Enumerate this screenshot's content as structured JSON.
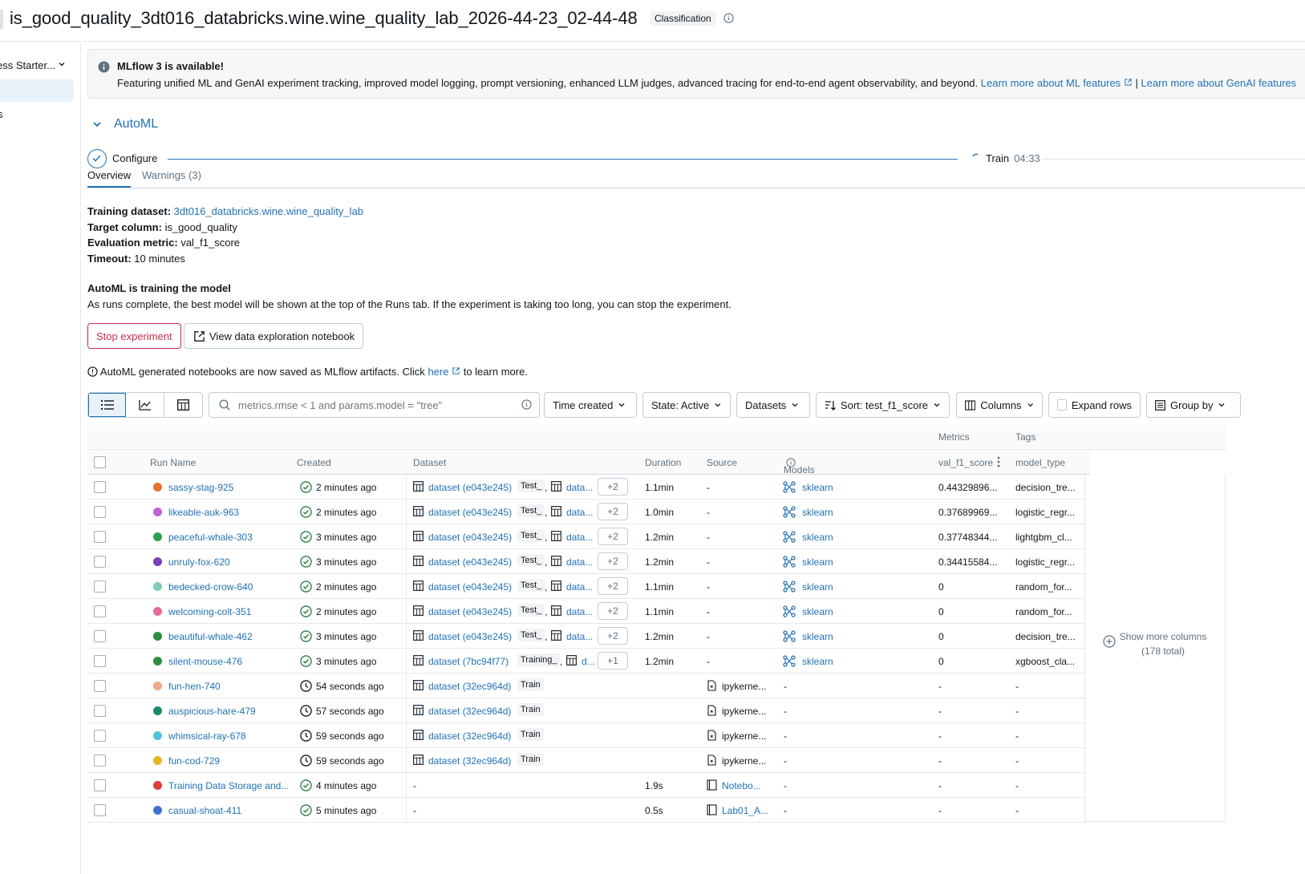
{
  "header": {
    "title": "is_good_quality_3dt016_databricks.wine.wine_quality_lab_2026-44-23_02-44-48",
    "badge": "Classification"
  },
  "sidebar": {
    "selector": "ess Starter...",
    "item2": "s"
  },
  "banner": {
    "title": "MLflow 3 is available!",
    "body": "Featuring unified ML and GenAI experiment tracking, improved model logging, prompt versioning, enhanced LLM judges, advanced tracing for end-to-end agent observability, and beyond.",
    "link1": "Learn more about ML features",
    "separator": "|",
    "link2": "Learn more about GenAI features"
  },
  "automl": {
    "section_title": "AutoML",
    "step1": "Configure",
    "step2": "Train",
    "step2_time": "04:33",
    "tabs": [
      "Overview",
      "Warnings (3)"
    ]
  },
  "info": {
    "training_dataset_label": "Training dataset:",
    "training_dataset": "3dt016_databricks.wine.wine_quality_lab",
    "target_label": "Target column:",
    "target": "is_good_quality",
    "metric_label": "Evaluation metric:",
    "metric": "val_f1_score",
    "timeout_label": "Timeout:",
    "timeout": "10 minutes",
    "status_title": "AutoML is training the model",
    "status_body": "As runs complete, the best model will be shown at the top of the Runs tab. If the experiment is taking too long, you can stop the experiment."
  },
  "actions": {
    "stop": "Stop experiment",
    "view_notebook": "View data exploration notebook"
  },
  "notice": {
    "text_before": "AutoML generated notebooks are now saved as MLflow artifacts. Click",
    "link": "here",
    "text_after": "to learn more."
  },
  "toolbar": {
    "search_placeholder": "metrics.rmse < 1 and params.model = \"tree\"",
    "time_created": "Time created",
    "state": "State: Active",
    "datasets": "Datasets",
    "sort": "Sort: test_f1_score",
    "columns": "Columns",
    "expand_rows": "Expand rows",
    "group_by": "Group by"
  },
  "table": {
    "group_metrics": "Metrics",
    "group_tags": "Tags",
    "columns": [
      "Run Name",
      "Created",
      "Dataset",
      "Duration",
      "Source",
      "Models",
      "val_f1_score",
      "model_type"
    ],
    "show_more": "Show more columns (178 total)",
    "rows": [
      {
        "name": "sassy-stag-925",
        "color": "#e8702a",
        "status": "done",
        "created": "2 minutes ago",
        "ds": "dataset (e043e245)",
        "tag": "Test_",
        "ds2": "data...",
        "more": "+2",
        "duration": "1.1min",
        "source": "-",
        "model": "sklearn",
        "metric": "0.44329896...",
        "type": "decision_tre..."
      },
      {
        "name": "likeable-auk-963",
        "color": "#c45fd6",
        "status": "done",
        "created": "2 minutes ago",
        "ds": "dataset (e043e245)",
        "tag": "Test_",
        "ds2": "data...",
        "more": "+2",
        "duration": "1.0min",
        "source": "-",
        "model": "sklearn",
        "metric": "0.37689969...",
        "type": "logistic_regr..."
      },
      {
        "name": "peaceful-whale-303",
        "color": "#2f9e4f",
        "status": "done",
        "created": "3 minutes ago",
        "ds": "dataset (e043e245)",
        "tag": "Test_",
        "ds2": "data...",
        "more": "+2",
        "duration": "1.2min",
        "source": "-",
        "model": "sklearn",
        "metric": "0.37748344...",
        "type": "lightgbm_cl..."
      },
      {
        "name": "unruly-fox-620",
        "color": "#7b3fb5",
        "status": "done",
        "created": "3 minutes ago",
        "ds": "dataset (e043e245)",
        "tag": "Test_",
        "ds2": "data...",
        "more": "+2",
        "duration": "1.2min",
        "source": "-",
        "model": "sklearn",
        "metric": "0.34415584...",
        "type": "logistic_regr..."
      },
      {
        "name": "bedecked-crow-640",
        "color": "#7fcdb8",
        "status": "done",
        "created": "2 minutes ago",
        "ds": "dataset (e043e245)",
        "tag": "Test_",
        "ds2": "data...",
        "more": "+2",
        "duration": "1.1min",
        "source": "-",
        "model": "sklearn",
        "metric": "0",
        "type": "random_for..."
      },
      {
        "name": "welcoming-colt-351",
        "color": "#e56b9a",
        "status": "done",
        "created": "2 minutes ago",
        "ds": "dataset (e043e245)",
        "tag": "Test_",
        "ds2": "data...",
        "more": "+2",
        "duration": "1.1min",
        "source": "-",
        "model": "sklearn",
        "metric": "0",
        "type": "random_for..."
      },
      {
        "name": "beautiful-whale-462",
        "color": "#2f8f3f",
        "status": "done",
        "created": "3 minutes ago",
        "ds": "dataset (e043e245)",
        "tag": "Test_",
        "ds2": "data...",
        "more": "+2",
        "duration": "1.2min",
        "source": "-",
        "model": "sklearn",
        "metric": "0",
        "type": "decision_tre..."
      },
      {
        "name": "silent-mouse-476",
        "color": "#2f8f3f",
        "status": "done",
        "created": "3 minutes ago",
        "ds": "dataset (7bc94f77)",
        "tag": "Training_",
        "ds2": "d...",
        "more": "+1",
        "duration": "1.2min",
        "source": "-",
        "model": "sklearn",
        "metric": "0",
        "type": "xgboost_cla..."
      },
      {
        "name": "fun-hen-740",
        "color": "#f0a98a",
        "status": "running",
        "created": "54 seconds ago",
        "ds": "dataset (32ec964d)",
        "tag": "Train",
        "ds2": "",
        "more": "",
        "duration": "",
        "source": "ipykerne...",
        "model": "-",
        "metric": "-",
        "type": "-"
      },
      {
        "name": "auspicious-hare-479",
        "color": "#1a8a6e",
        "status": "running",
        "created": "57 seconds ago",
        "ds": "dataset (32ec964d)",
        "tag": "Train",
        "ds2": "",
        "more": "",
        "duration": "",
        "source": "ipykerne...",
        "model": "-",
        "metric": "-",
        "type": "-"
      },
      {
        "name": "whimsical-ray-678",
        "color": "#4fc3d9",
        "status": "running",
        "created": "59 seconds ago",
        "ds": "dataset (32ec964d)",
        "tag": "Train",
        "ds2": "",
        "more": "",
        "duration": "",
        "source": "ipykerne...",
        "model": "-",
        "metric": "-",
        "type": "-"
      },
      {
        "name": "fun-cod-729",
        "color": "#e8b520",
        "status": "running",
        "created": "59 seconds ago",
        "ds": "dataset (32ec964d)",
        "tag": "Train",
        "ds2": "",
        "more": "",
        "duration": "",
        "source": "ipykerne...",
        "model": "-",
        "metric": "-",
        "type": "-"
      },
      {
        "name": "Training Data Storage and...",
        "color": "#e03b3b",
        "status": "done",
        "created": "4 minutes ago",
        "ds": "-",
        "tag": "",
        "ds2": "",
        "more": "",
        "duration": "1.9s",
        "source": "Notebo...",
        "model": "-",
        "metric": "-",
        "type": "-"
      },
      {
        "name": "casual-shoat-411",
        "color": "#3d6fd6",
        "status": "done",
        "created": "5 minutes ago",
        "ds": "-",
        "tag": "",
        "ds2": "",
        "more": "",
        "duration": "0.5s",
        "source": "Lab01_A...",
        "model": "-",
        "metric": "-",
        "type": "-"
      }
    ]
  }
}
